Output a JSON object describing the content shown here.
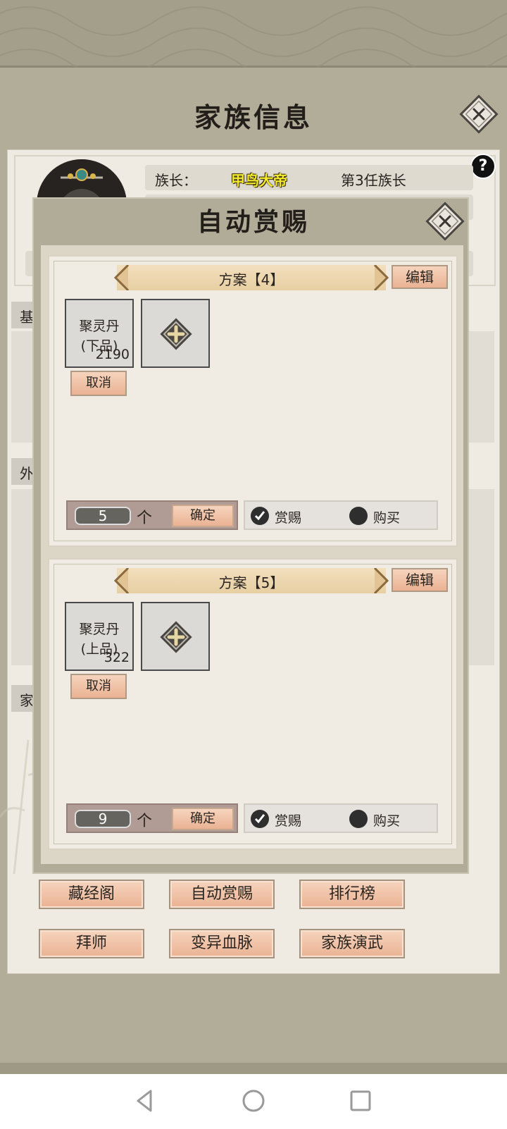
{
  "page": {
    "title": "家族信息",
    "leader": {
      "label": "族长：",
      "name": "甲鸟大帝",
      "generation": "第3任族长"
    },
    "side_tabs": [
      "基",
      "外",
      "家"
    ],
    "help_symbol": "?",
    "buttons": [
      {
        "label": "藏经阁"
      },
      {
        "label": "自动赏赐"
      },
      {
        "label": "排行榜"
      },
      {
        "label": "拜师"
      },
      {
        "label": "变异血脉"
      },
      {
        "label": "家族演武"
      }
    ]
  },
  "modal": {
    "title": "自动赏赐",
    "schemes": [
      {
        "title": "方案【4】",
        "edit_label": "编辑",
        "item": {
          "name": "聚灵丹",
          "grade": "(下品)",
          "count": "2190"
        },
        "cancel_label": "取消",
        "quantity": "5",
        "unit": "个",
        "confirm_label": "确定",
        "mode_reward": "赏赐",
        "mode_buy": "购买",
        "selected_mode": "赏赐"
      },
      {
        "title": "方案【5】",
        "edit_label": "编辑",
        "item": {
          "name": "聚灵丹",
          "grade": "(上品)",
          "count": "322"
        },
        "cancel_label": "取消",
        "quantity": "9",
        "unit": "个",
        "confirm_label": "确定",
        "mode_reward": "赏赐",
        "mode_buy": "购买",
        "selected_mode": "赏赐"
      }
    ]
  },
  "icons": {
    "close": "close-icon",
    "add": "add-item-icon",
    "help": "help-icon",
    "check": "check-icon",
    "back": "back-triangle-icon",
    "home": "home-circle-icon",
    "recents": "recents-square-icon"
  },
  "colors": {
    "leader_name": "#f3ec2c",
    "button_fill": "#eab293",
    "panel_bg": "#efebe2"
  }
}
